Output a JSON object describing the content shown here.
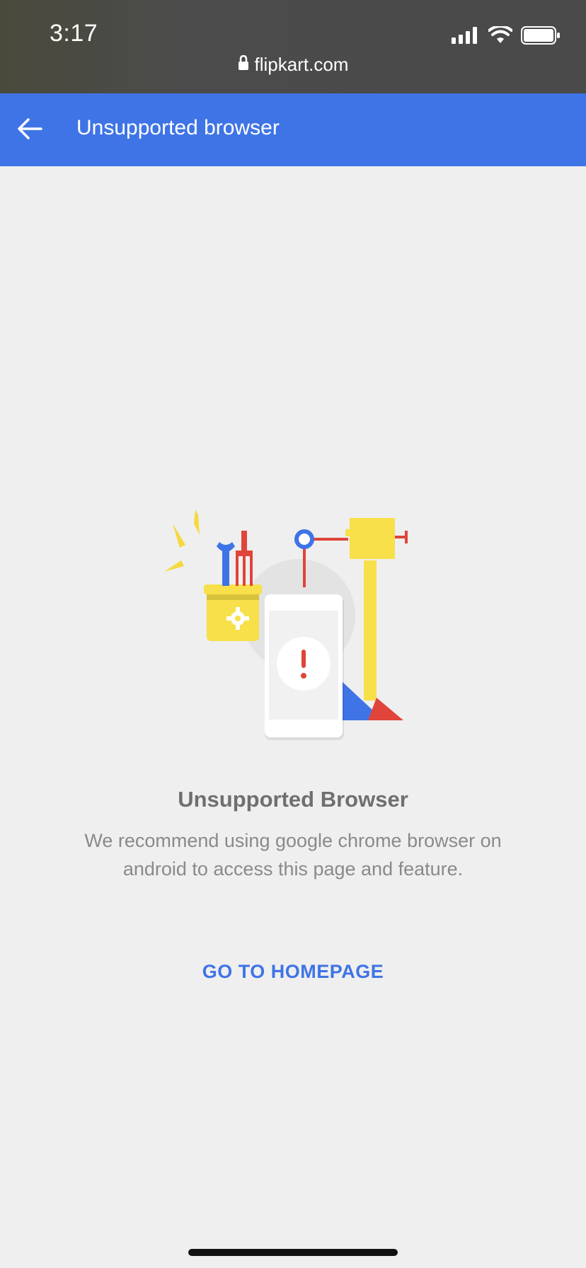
{
  "status_bar": {
    "time": "3:17",
    "url": "flipkart.com",
    "icons": [
      "signal-icon",
      "wifi-icon",
      "battery-icon"
    ]
  },
  "app_bar": {
    "title": "Unsupported browser",
    "back_icon": "arrow-left-icon",
    "color": "#3f74e6"
  },
  "content": {
    "title": "Unsupported Browser",
    "message": "We recommend using google chrome browser on android to access this page and feature.",
    "cta_label": "GO TO HOMEPAGE"
  },
  "colors": {
    "accent": "#3f74e6",
    "background": "#efefef"
  }
}
